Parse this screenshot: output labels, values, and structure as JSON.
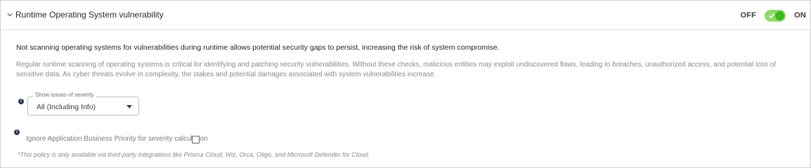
{
  "header": {
    "title": "Runtime Operating System vulnerability",
    "expand_icon": "chevron-down-icon",
    "toggle": {
      "off_label": "OFF",
      "on_label": "ON",
      "state": "on",
      "track_color": "#8fd96b",
      "knob_color": "#3fb819"
    }
  },
  "content": {
    "summary": "Not scanning operating systems for vulnerabilities during runtime allows potential security gaps to persist, increasing the risk of system compromise.",
    "description": "Regular runtime scanning of operating systems is critical for identifying and patching security vulnerabilities. Without these checks, malicious entities may exploit undiscovered flaws, leading to breaches, unauthorized access, and potential loss of sensitive data. As cyber threats evolve in complexity, the stakes and potential damages associated with system vulnerabilities increase."
  },
  "severity": {
    "legend": "Show issues of severity",
    "selected": "All (Including Info)"
  },
  "ignore_priority": {
    "label": "Ignore Application Business Priority for severity calculation",
    "checked": false
  },
  "note": "*This policy is only available via third-party integrations like Prisma Cloud, Wiz, Orca, Oligo, and Microsoft Defender for Cloud."
}
